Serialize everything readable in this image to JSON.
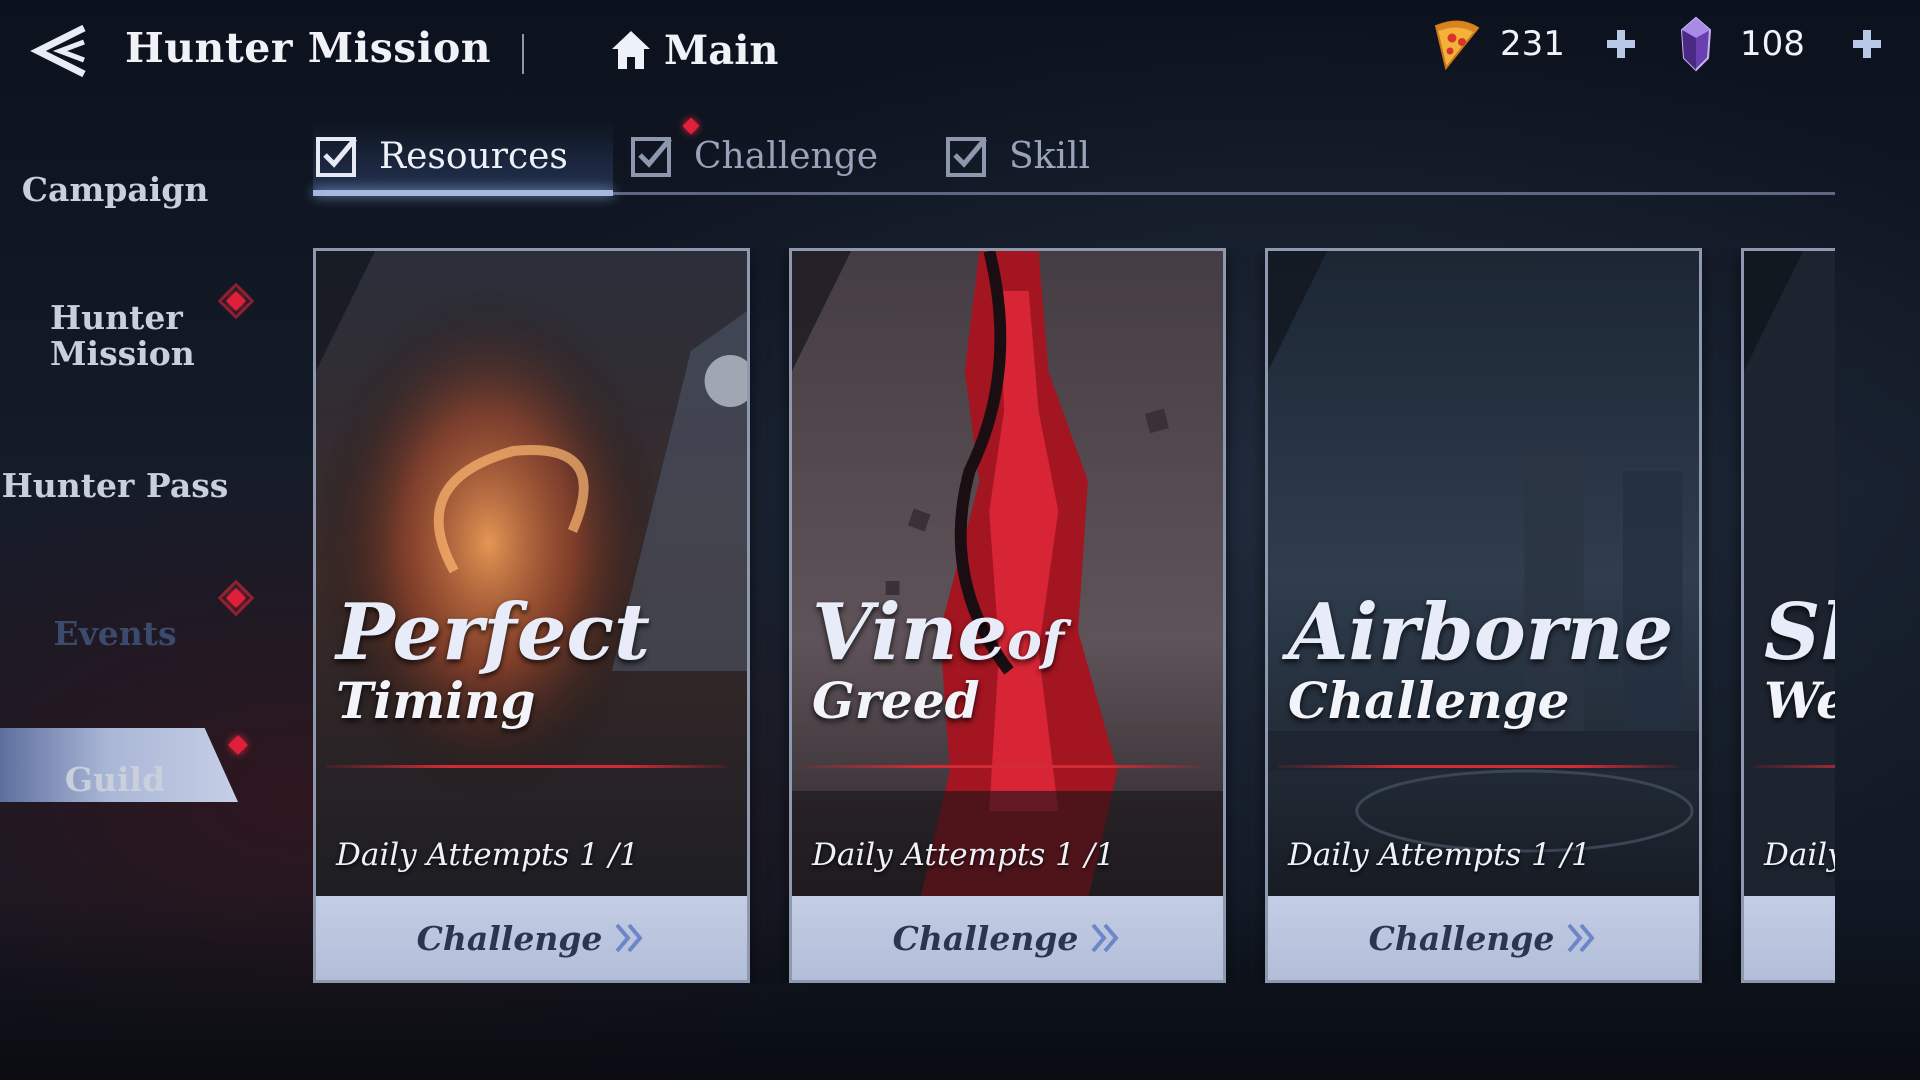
{
  "header": {
    "title": "Hunter Mission",
    "home_label": "Main"
  },
  "currencies": [
    {
      "icon": "pizza-icon",
      "value": "231"
    },
    {
      "icon": "purple-crystal-icon",
      "value": "108"
    }
  ],
  "sidebar": {
    "items": [
      {
        "label": "Campaign",
        "badge": false
      },
      {
        "label": "Hunter Mission",
        "badge": true
      },
      {
        "label": "Hunter Pass",
        "badge": false
      },
      {
        "label": "Events",
        "badge": true,
        "active": true
      },
      {
        "label": "Guild",
        "badge": true
      }
    ]
  },
  "tabs": [
    {
      "label": "Resources",
      "active": true,
      "badge": false
    },
    {
      "label": "Challenge",
      "active": false,
      "badge": true
    },
    {
      "label": "Skill",
      "active": false,
      "badge": false
    }
  ],
  "cards": [
    {
      "title_line1": "Perfect",
      "title_line2": "Timing",
      "attempts": "Daily Attempts 1 /1",
      "button": "Challenge"
    },
    {
      "title_line1": "Vine",
      "title_of": "of",
      "title_line2": "Greed",
      "attempts": "Daily Attempts 1 /1",
      "button": "Challenge"
    },
    {
      "title_line1": "Airborne",
      "title_line2": "Challenge",
      "attempts": "Daily Attempts 1 /1",
      "button": "Challenge"
    },
    {
      "title_line1": "Sl",
      "title_line2": "We",
      "attempts": "Daily",
      "button": ""
    }
  ],
  "colors": {
    "accent_tab": "#a7b8e0",
    "badge_red": "#e0203a",
    "button_bg": "#bcc6df",
    "button_text": "#2b3552"
  }
}
